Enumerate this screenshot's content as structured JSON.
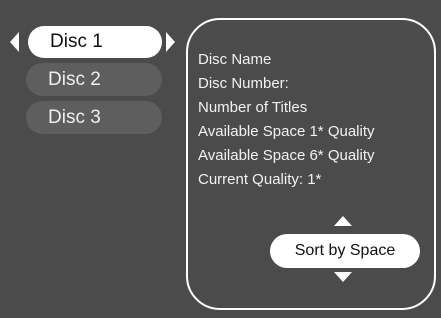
{
  "colors": {
    "background": "#4b4b4b",
    "selected_button": "#ffffff",
    "unselected_button": "#5e5e5e",
    "text_light": "#f2f2f2",
    "text_dark": "#111111"
  },
  "disc_list": {
    "items": [
      {
        "label": "Disc 1",
        "selected": true
      },
      {
        "label": "Disc 2",
        "selected": false
      },
      {
        "label": "Disc 3",
        "selected": false
      }
    ],
    "left_arrow_icon": "triangle-left",
    "right_arrow_icon": "triangle-right"
  },
  "info_panel": {
    "lines": [
      "Disc Name",
      "Disc Number:",
      "Number of Titles",
      "Available Space 1* Quality",
      "Available Space 6* Quality",
      "Current Quality: 1*"
    ],
    "sort": {
      "label": "Sort by Space",
      "up_icon": "triangle-up",
      "down_icon": "triangle-down"
    }
  }
}
